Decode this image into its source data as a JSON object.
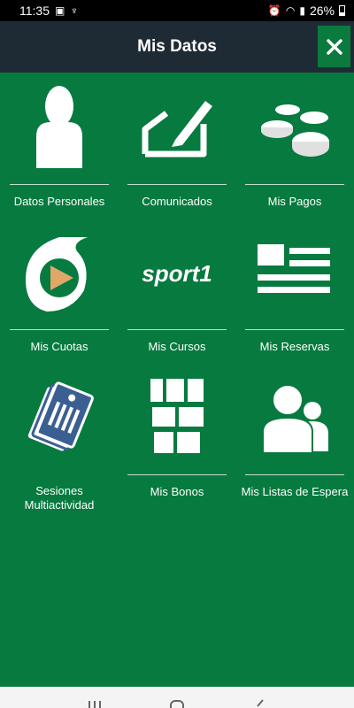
{
  "status_bar": {
    "time": "11:35",
    "battery": "26%"
  },
  "header": {
    "title": "Mis Datos",
    "close_label": "Cerrar"
  },
  "tiles": [
    {
      "label": "Datos Personales"
    },
    {
      "label": "Comunicados"
    },
    {
      "label": "Mis Pagos"
    },
    {
      "label": "Mis Cuotas"
    },
    {
      "label": "Mis Cursos"
    },
    {
      "label": "Mis Reservas"
    },
    {
      "label": "Sesiones Multiactividad"
    },
    {
      "label": "Mis Bonos"
    },
    {
      "label": "Mis Listas de Espera"
    }
  ],
  "logo_text": "sport1",
  "icons": {
    "tile_0": "person-icon",
    "tile_1": "edit-icon",
    "tile_2": "coins-icon",
    "tile_3": "play-badge-icon",
    "tile_4": "sport1-logo",
    "tile_5": "list-icon",
    "tile_6": "tickets-icon",
    "tile_7": "voucher-grid-icon",
    "tile_8": "users-icon"
  },
  "colors": {
    "background": "#077a3f",
    "header": "#1f2b34",
    "accent": "#0b7a3e"
  }
}
